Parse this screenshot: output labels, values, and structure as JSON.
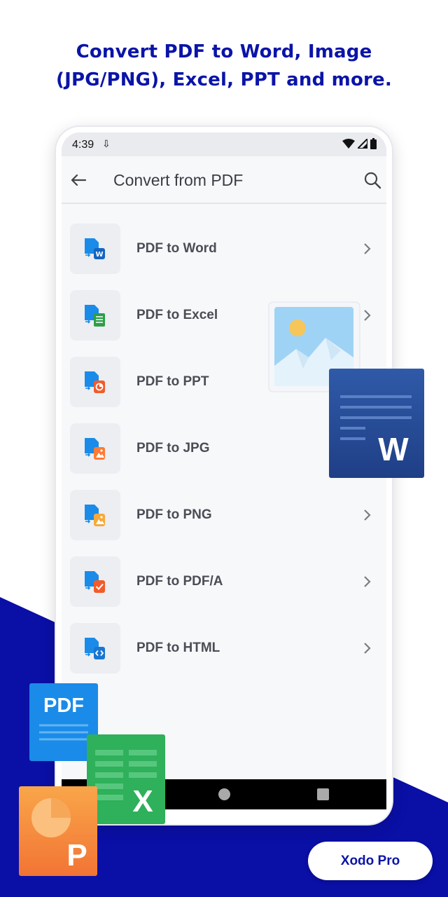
{
  "headline": {
    "line1": "Convert PDF to Word, Image",
    "line2": "(JPG/PNG), Excel, PPT and more."
  },
  "status_bar": {
    "time": "4:39",
    "download_glyph": "⇩"
  },
  "app_bar": {
    "title": "Convert from PDF"
  },
  "conversions": [
    {
      "label": "PDF to Word",
      "icon": "word-badge-icon",
      "color": "#1565c0"
    },
    {
      "label": "PDF to Excel",
      "icon": "excel-badge-icon",
      "color": "#2e9e48"
    },
    {
      "label": "PDF to PPT",
      "icon": "ppt-badge-icon",
      "color": "#f25c2a"
    },
    {
      "label": "PDF to JPG",
      "icon": "jpg-badge-icon",
      "color": "#ff7a33"
    },
    {
      "label": "PDF to PNG",
      "icon": "png-badge-icon",
      "color": "#f6a93b"
    },
    {
      "label": "PDF to PDF/A",
      "icon": "pdfa-badge-icon",
      "color": "#f25c2a"
    },
    {
      "label": "PDF to HTML",
      "icon": "html-badge-icon",
      "color": "#1976d2"
    }
  ],
  "decor": {
    "pdf_file_label": "PDF",
    "word_letter": "W",
    "excel_letter": "X",
    "ppt_letter": "P"
  },
  "colors": {
    "brand_blue": "#0a14a8",
    "doc_blue": "#1a8be8"
  },
  "cta": {
    "label": "Xodo Pro"
  }
}
